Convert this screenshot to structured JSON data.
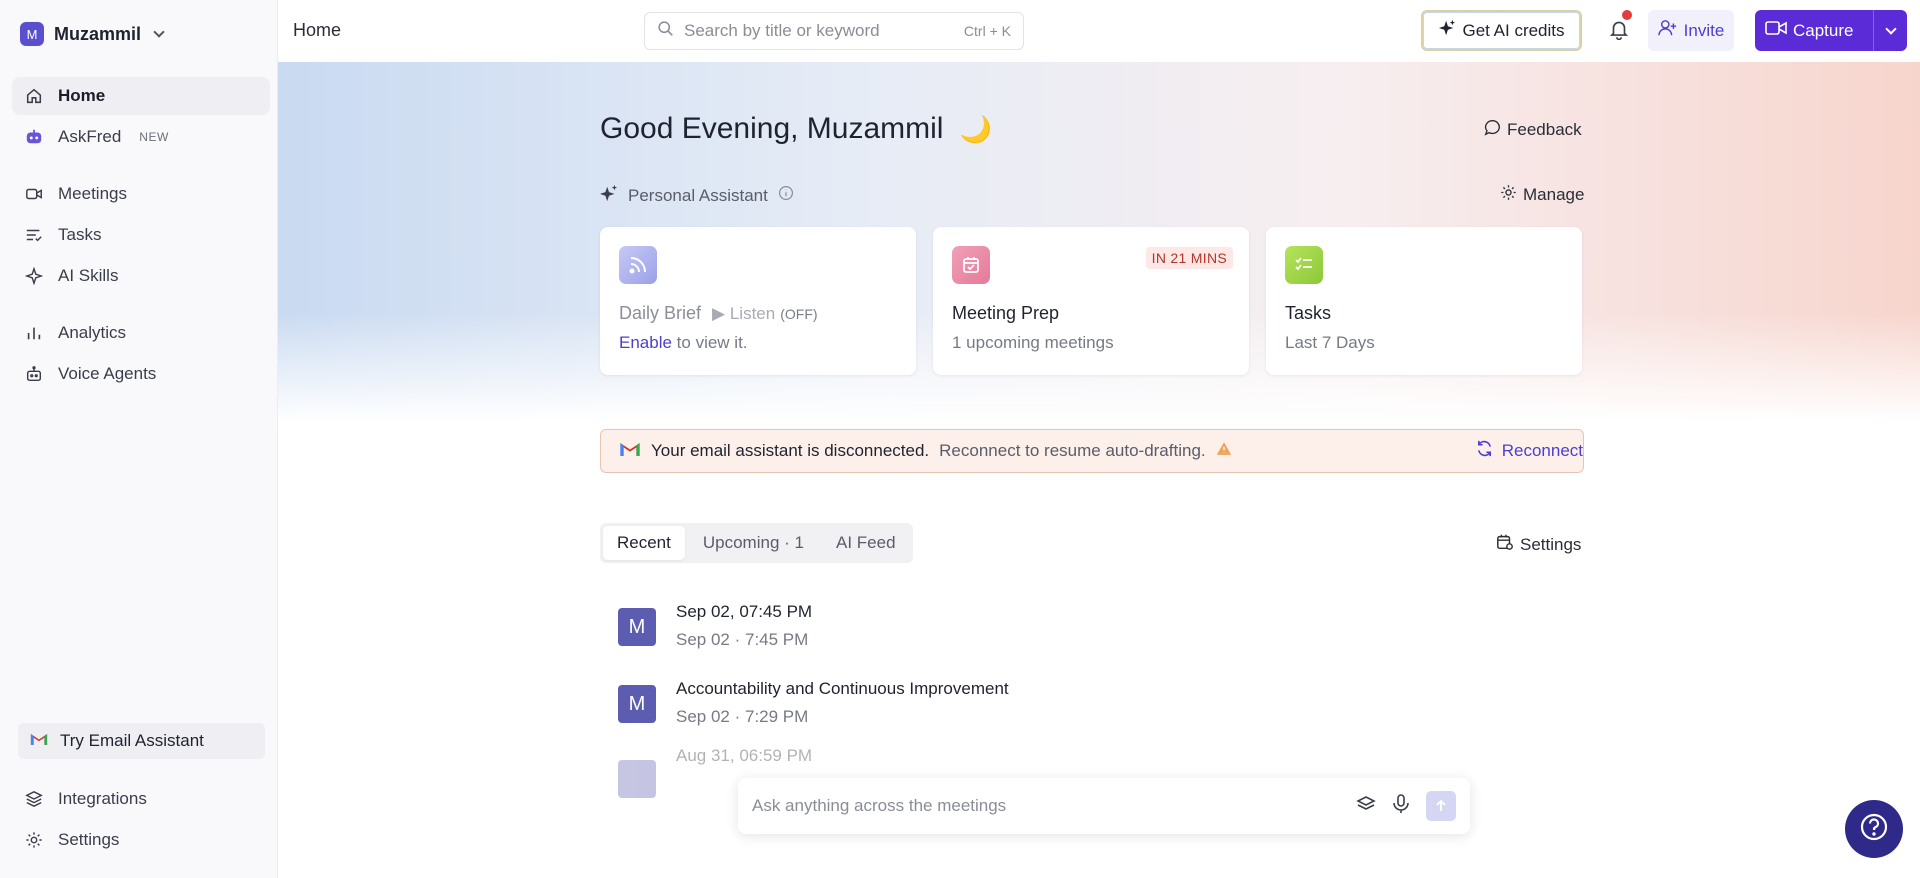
{
  "workspace": {
    "initial": "M",
    "name": "Muzammil"
  },
  "sidebar": {
    "items": [
      {
        "label": "Home"
      },
      {
        "label": "AskFred",
        "badge": "NEW"
      },
      {
        "label": "Meetings"
      },
      {
        "label": "Tasks"
      },
      {
        "label": "AI Skills"
      },
      {
        "label": "Analytics"
      },
      {
        "label": "Voice Agents"
      }
    ],
    "try_email": "Try Email Assistant",
    "bottom_items": [
      {
        "label": "Integrations"
      },
      {
        "label": "Settings"
      }
    ]
  },
  "topbar": {
    "breadcrumb": "Home",
    "search_placeholder": "Search by title or keyword",
    "search_shortcut": "Ctrl + K",
    "credits_label": "Get AI credits",
    "invite_label": "Invite",
    "capture_label": "Capture"
  },
  "main": {
    "greeting": "Good Evening, Muzammil",
    "greeting_emoji": "🌙",
    "feedback_label": "Feedback",
    "assistant_label": "Personal Assistant",
    "manage_label": "Manage",
    "cards": {
      "brief": {
        "title": "Daily Brief",
        "listen": "Listen",
        "off": "(OFF)",
        "enable": "Enable",
        "sub": "to view it."
      },
      "prep": {
        "title": "Meeting Prep",
        "sub": "1 upcoming meetings",
        "tag": "IN 21 MINS"
      },
      "tasks": {
        "title": "Tasks",
        "sub": "Last 7 Days"
      }
    },
    "banner": {
      "bold": "Your email assistant is disconnected.",
      "text": "Reconnect to resume auto-drafting.",
      "action": "Reconnect"
    },
    "tabs": [
      "Recent",
      "Upcoming · 1",
      "AI Feed"
    ],
    "settings_label": "Settings",
    "meetings": [
      {
        "initial": "M",
        "title": "Sep 02, 07:45 PM",
        "date": "Sep 02",
        "time": "7:45 PM"
      },
      {
        "initial": "M",
        "title": "Accountability and Continuous Improvement",
        "date": "Sep 02",
        "time": "7:29 PM"
      },
      {
        "initial": "",
        "title": "Aug 31, 06:59 PM",
        "date": "",
        "time": ""
      }
    ],
    "ask_placeholder": "Ask anything across the meetings"
  },
  "colors": {
    "accent": "#5b2bd8",
    "link": "#4c3fd0",
    "avatar": "#5c5cb0",
    "help": "#2f2a8a"
  }
}
